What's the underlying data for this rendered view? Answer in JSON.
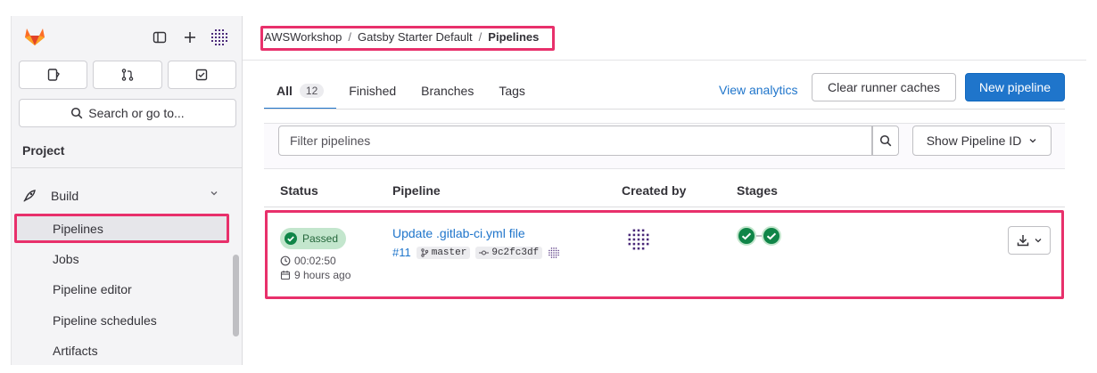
{
  "sidebar": {
    "search_label": "Search or go to...",
    "section_title": "Project",
    "build_label": "Build",
    "items": [
      {
        "label": "Pipelines"
      },
      {
        "label": "Jobs"
      },
      {
        "label": "Pipeline editor"
      },
      {
        "label": "Pipeline schedules"
      },
      {
        "label": "Artifacts"
      }
    ]
  },
  "breadcrumb": {
    "items": [
      "AWSWorkshop",
      "Gatsby Starter Default",
      "Pipelines"
    ],
    "separator": "/"
  },
  "tabs": [
    {
      "label": "All",
      "count": "12"
    },
    {
      "label": "Finished"
    },
    {
      "label": "Branches"
    },
    {
      "label": "Tags"
    }
  ],
  "actions": {
    "view_analytics": "View analytics",
    "clear_caches": "Clear runner caches",
    "new_pipeline": "New pipeline"
  },
  "filter": {
    "placeholder": "Filter pipelines",
    "show_id_label": "Show Pipeline ID"
  },
  "table": {
    "headers": [
      "Status",
      "Pipeline",
      "Created by",
      "Stages"
    ],
    "rows": [
      {
        "status": "Passed",
        "duration": "00:02:50",
        "finished": "9 hours ago",
        "title": "Update .gitlab-ci.yml file",
        "id": "#11",
        "branch": "master",
        "commit": "9c2fc3df"
      }
    ]
  },
  "colors": {
    "accent": "#1f75cb",
    "success": "#108548",
    "highlight": "#e8306b"
  }
}
